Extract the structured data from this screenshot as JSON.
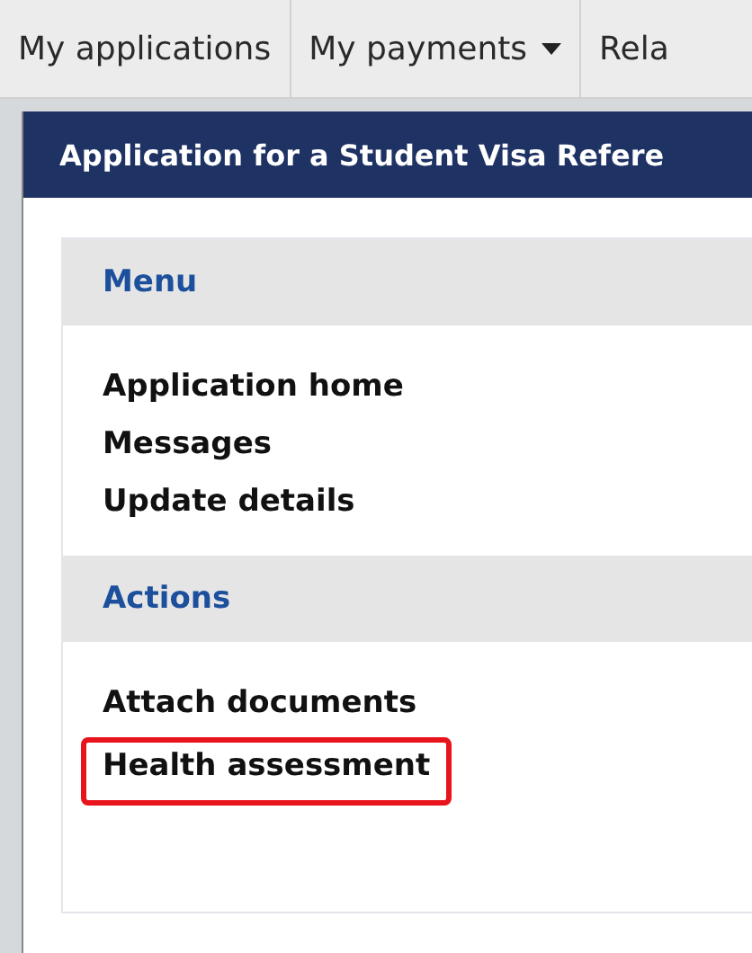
{
  "nav_tabs": [
    {
      "label": "My applications",
      "dropdown": false
    },
    {
      "label": "My payments",
      "dropdown": true
    },
    {
      "label": "Rela",
      "dropdown": false
    }
  ],
  "panel": {
    "title": "Application for a Student Visa Refere"
  },
  "sections": [
    {
      "heading": "Menu",
      "items": [
        {
          "label": "Application home",
          "highlighted": false
        },
        {
          "label": "Messages",
          "highlighted": false
        },
        {
          "label": "Update details",
          "highlighted": false
        }
      ]
    },
    {
      "heading": "Actions",
      "items": [
        {
          "label": "Attach documents",
          "highlighted": false
        },
        {
          "label": "Health assessment",
          "highlighted": true
        }
      ]
    }
  ]
}
